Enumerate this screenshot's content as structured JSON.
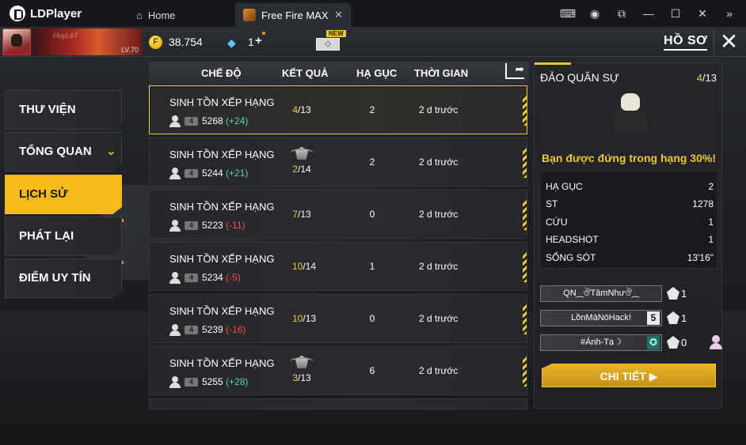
{
  "emulator": {
    "app_name": "LDPlayer",
    "tabs": [
      {
        "label": "Home",
        "icon": "home-icon"
      },
      {
        "label": "Free Fire MAX",
        "icon": "free-fire-icon"
      }
    ],
    "window_controls": [
      "gamepad-icon",
      "account-icon",
      "resize-icon",
      "minimize-icon",
      "maximize-icon",
      "close-icon",
      "expand-sidebar-icon"
    ]
  },
  "topbar": {
    "banner_name": "HuyLêT",
    "level": "LV.70",
    "gold": "38.754",
    "diamonds": "1",
    "new_badge": "NEW",
    "page_title": "HỒ SƠ"
  },
  "menu": [
    {
      "label": "THƯ VIỆN",
      "active": false
    },
    {
      "label": "TỔNG QUAN",
      "active": false,
      "chevron": "chevron-down-icon"
    },
    {
      "label": "LỊCH SỬ",
      "active": true
    },
    {
      "label": "PHÁT LẠI",
      "active": false
    },
    {
      "label": "ĐIỂM UY TÍN",
      "active": false
    }
  ],
  "table": {
    "headers": {
      "mode": "CHẾ ĐỘ",
      "result": "KẾT QUẢ",
      "kills": "HẠ GỤC",
      "time": "THỜI GIAN"
    },
    "rows": [
      {
        "mode": "SINH TỒN XẾP HẠNG",
        "squad": "4",
        "rating": "5268",
        "delta": "(+24)",
        "rank": "4",
        "total": "/13",
        "kills": "2",
        "time": "2 d trước",
        "badge": false,
        "selected": true
      },
      {
        "mode": "SINH TỒN XẾP HẠNG",
        "squad": "4",
        "rating": "5244",
        "delta": "(+21)",
        "rank": "2",
        "total": "/14",
        "kills": "2",
        "time": "2 d trước",
        "badge": true,
        "selected": false
      },
      {
        "mode": "SINH TỒN XẾP HẠNG",
        "squad": "4",
        "rating": "5223",
        "delta": "(-11)",
        "rank": "7",
        "total": "/13",
        "kills": "0",
        "time": "2 d trước",
        "badge": false,
        "selected": false
      },
      {
        "mode": "SINH TỒN XẾP HẠNG",
        "squad": "4",
        "rating": "5234",
        "delta": "(-5)",
        "rank": "10",
        "total": "/14",
        "kills": "1",
        "time": "2 d trước",
        "badge": false,
        "selected": false
      },
      {
        "mode": "SINH TỒN XẾP HẠNG",
        "squad": "4",
        "rating": "5239",
        "delta": "(-16)",
        "rank": "10",
        "total": "/13",
        "kills": "0",
        "time": "2 d trước",
        "badge": false,
        "selected": false
      },
      {
        "mode": "SINH TỒN XẾP HẠNG",
        "squad": "4",
        "rating": "5255",
        "delta": "(+28)",
        "rank": "3",
        "total": "/13",
        "kills": "6",
        "time": "2 d trước",
        "badge": true,
        "selected": false
      }
    ]
  },
  "detail": {
    "title": "ĐẢO QUÂN SỰ",
    "rank": "4",
    "total": "/13",
    "message": "Bạn được đứng trong hạng 30%!",
    "stats": [
      {
        "label": "HẠ GỤC",
        "value": "2"
      },
      {
        "label": "ST",
        "value": "1278"
      },
      {
        "label": "CỨU",
        "value": "1"
      },
      {
        "label": "HEADSHOT",
        "value": "1"
      },
      {
        "label": "SỐNG SÓT",
        "value": "13'16\""
      }
    ],
    "team": [
      {
        "name": "QN⁔ঔTâmNhưঔ⁔",
        "level": "",
        "kills": "1",
        "add_friend": false
      },
      {
        "name": "LồnMáNóHack!",
        "level": "5",
        "kills": "1",
        "add_friend": false
      },
      {
        "name": "#Ánh-Tạ☽",
        "level": "",
        "kills": "0",
        "add_friend": true
      }
    ],
    "details_button": "CHI TIẾT ▶"
  },
  "colors": {
    "accent": "#f3c431",
    "active_menu": "#f6b91a",
    "positive": "#58d6a6",
    "negative": "#ff4b3e"
  }
}
